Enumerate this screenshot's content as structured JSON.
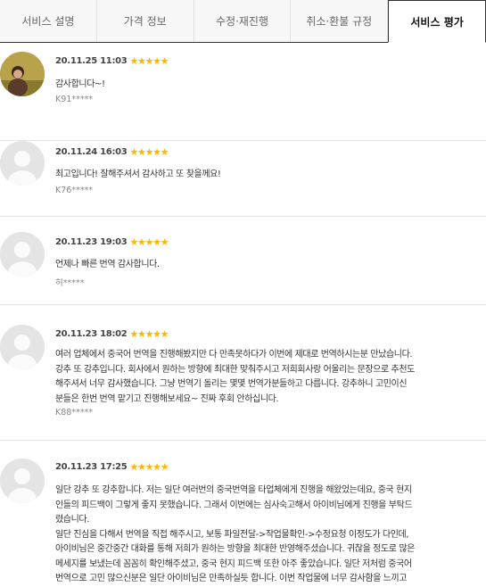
{
  "tabs": [
    {
      "label": "서비스 설명"
    },
    {
      "label": "가격 정보"
    },
    {
      "label": "수정·재진행"
    },
    {
      "label": "취소·환불 규정"
    },
    {
      "label": "서비스 평가"
    }
  ],
  "reviews": [
    {
      "date": "20.11.25 11:03",
      "rating": 5,
      "text": "감사합니다~!",
      "author": "K91*****",
      "avatar": "photo"
    },
    {
      "date": "20.11.24 16:03",
      "rating": 5,
      "text": "최고입니다! 잘해주셔서 감사하고 또 찾을께요!",
      "author": "K76*****",
      "avatar": "default"
    },
    {
      "date": "20.11.23 19:03",
      "rating": 5,
      "text": "언제나 빠른 번역 감사합니다.",
      "author": "허*****",
      "avatar": "default"
    },
    {
      "date": "20.11.23 18:02",
      "rating": 5,
      "text": "여러 업체에서 중국어 번역을 진행해봤지만 다 만족못하다가 이번에 제대로 번역하시는분 만났습니다.\n강추 또 강추입니다. 회사에서 원하는 방향에 최대한 맞춰주시고 저희회사랑 어울리는 문장으로 추천도\n해주셔서 너무 감사했습니다. 그냥 번역기 돌리는 몇몇 번역가분들하고 다릅니다. 강추하니 고민이신\n분들은 한번 번역 맡기고 진행해보세요~ 진짜 후회 안하십니다.",
      "author": "K88*****",
      "avatar": "default"
    },
    {
      "date": "20.11.23 17:25",
      "rating": 5,
      "text": "일단 강추 또 강추합니다. 저는 일단 여러번의 중국번역을 타업체에게 진행을 해왔었는데요, 중국 현지\n인들의 피드백이 그렇게 좋지 못했습니다. 그래서 이번에는 심사숙고해서 아이비님에게 진행을 부탁드\n렸습니다.\n일단 진심을 다해서 번역을 직접 해주시고, 보통 파일전달->작업물확인->수정요청 이정도가 다인데,\n아이비님은 중간중간 대화를 통해 저희가 원하는 방향을 최대한 반영해주셨습니다. 귀찮을 정도로 많은\n메세지를 보냈는데 꼼꼼히 확인해주셨고, 중국 현지 피드백 또한 아주 좋았습니다. 일단 저처럼 중국어\n번역으로 고민 많으신분은 일단 아이비님은 만족하실듯 합니다. 이번 작업물에 너무 감사함을 느끼고",
      "author": "",
      "avatar": "default"
    }
  ],
  "colors": {
    "star": "#f6b800",
    "active_border": "#333333"
  }
}
